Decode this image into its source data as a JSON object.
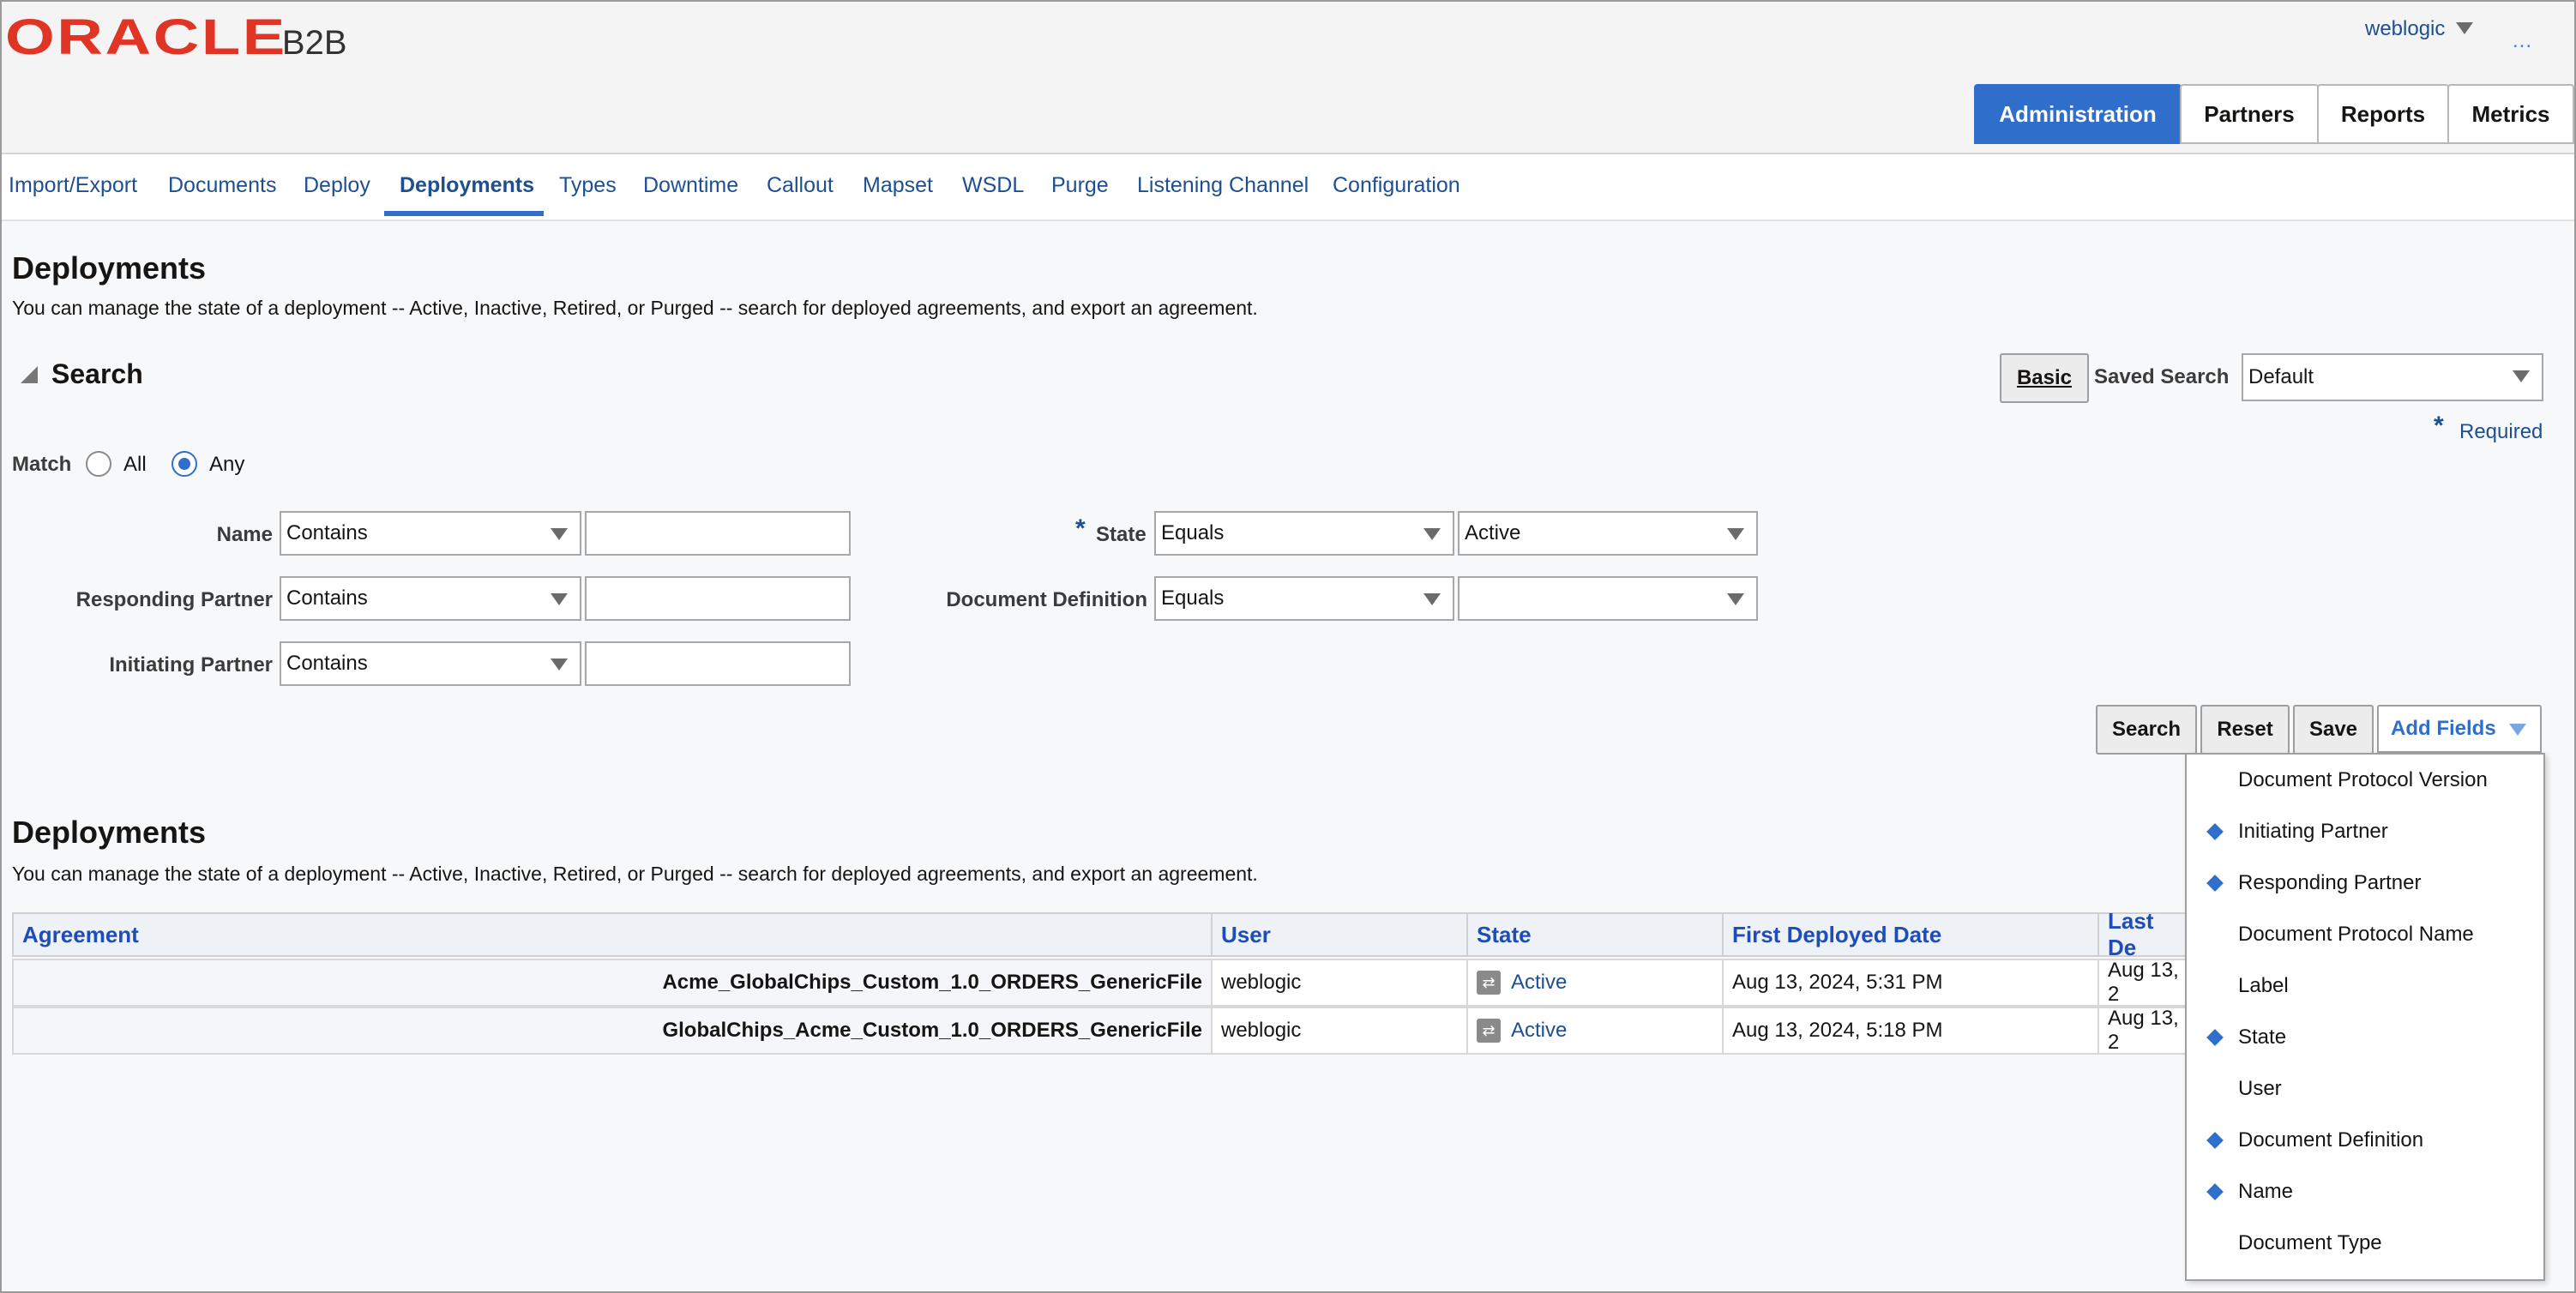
{
  "header": {
    "brand": "ORACLE",
    "product": "B2B",
    "user": "weblogic",
    "overflow": "..."
  },
  "main_tabs": [
    {
      "label": "Administration",
      "active": true
    },
    {
      "label": "Partners",
      "active": false
    },
    {
      "label": "Reports",
      "active": false
    },
    {
      "label": "Metrics",
      "active": false
    }
  ],
  "sub_tabs": [
    {
      "label": "Import/Export"
    },
    {
      "label": "Documents"
    },
    {
      "label": "Deploy"
    },
    {
      "label": "Deployments",
      "active": true
    },
    {
      "label": "Types"
    },
    {
      "label": "Downtime"
    },
    {
      "label": "Callout"
    },
    {
      "label": "Mapset"
    },
    {
      "label": "WSDL"
    },
    {
      "label": "Purge"
    },
    {
      "label": "Listening Channel"
    },
    {
      "label": "Configuration"
    }
  ],
  "page": {
    "title": "Deployments",
    "description": "You can manage the state of a deployment -- Active, Inactive, Retired, or Purged -- search for deployed agreements, and export an agreement."
  },
  "search": {
    "title": "Search",
    "basic_button": "Basic",
    "saved_search_label": "Saved Search",
    "saved_search_value": "Default",
    "required_star": "*",
    "required_label": "Required",
    "match_label": "Match",
    "match_all": "All",
    "match_any": "Any",
    "match_selected": "Any",
    "fields": {
      "name_label": "Name",
      "name_operator": "Contains",
      "name_value": "",
      "responding_label": "Responding Partner",
      "responding_operator": "Contains",
      "responding_value": "",
      "initiating_label": "Initiating Partner",
      "initiating_operator": "Contains",
      "initiating_value": "",
      "state_star": "*",
      "state_label": "State",
      "state_operator": "Equals",
      "state_value": "Active",
      "docdef_label": "Document Definition",
      "docdef_operator": "Equals",
      "docdef_value": ""
    },
    "buttons": {
      "search": "Search",
      "reset": "Reset",
      "save": "Save",
      "add_fields": "Add Fields"
    }
  },
  "add_fields_menu": [
    {
      "label": "Document Protocol Version",
      "selected": false
    },
    {
      "label": "Initiating Partner",
      "selected": true
    },
    {
      "label": "Responding Partner",
      "selected": true
    },
    {
      "label": "Document Protocol Name",
      "selected": false
    },
    {
      "label": "Label",
      "selected": false
    },
    {
      "label": "State",
      "selected": true
    },
    {
      "label": "User",
      "selected": false
    },
    {
      "label": "Document Definition",
      "selected": true
    },
    {
      "label": "Name",
      "selected": true
    },
    {
      "label": "Document Type",
      "selected": false
    }
  ],
  "results": {
    "title": "Deployments",
    "description": "You can manage the state of a deployment -- Active, Inactive, Retired, or Purged -- search for deployed agreements, and export an agreement.",
    "columns": [
      "Agreement",
      "User",
      "State",
      "First Deployed Date",
      "Last De"
    ],
    "rows": [
      {
        "agreement": "Acme_GlobalChips_Custom_1.0_ORDERS_GenericFile",
        "user": "weblogic",
        "state": "Active",
        "first_deployed": "Aug 13, 2024, 5:31 PM",
        "last_deployed": "Aug 13, 2"
      },
      {
        "agreement": "GlobalChips_Acme_Custom_1.0_ORDERS_GenericFile",
        "user": "weblogic",
        "state": "Active",
        "first_deployed": "Aug 13, 2024, 5:18 PM",
        "last_deployed": "Aug 13, 2"
      }
    ]
  }
}
